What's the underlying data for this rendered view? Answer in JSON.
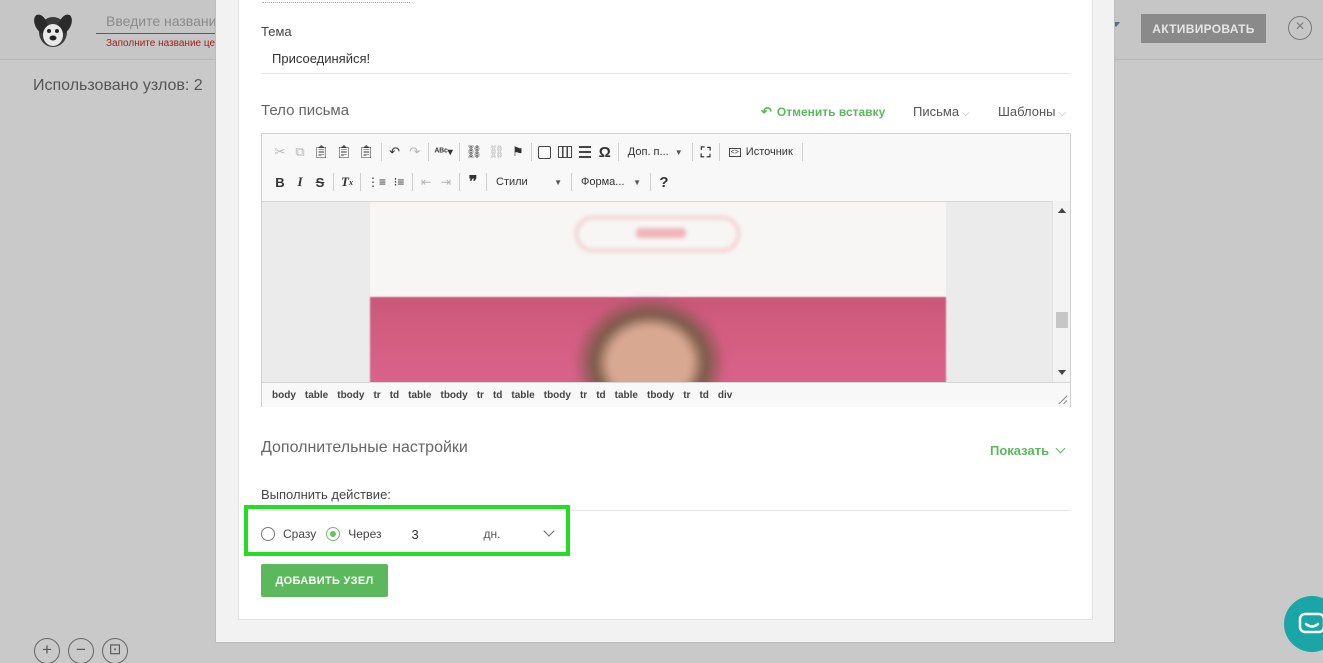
{
  "header": {
    "logo_icon": "dog-logo-icon",
    "name_placeholder": "Введите название",
    "name_error": "Заполните название цепочки",
    "activate_label": "АКТИВИРОВАТЬ",
    "close_icon": "close-icon"
  },
  "canvas": {
    "nodes_used": "Использовано узлов: 2",
    "zoom_in": "+",
    "zoom_out": "−",
    "fit": "⊡"
  },
  "modal": {
    "subject_label": "Тема",
    "subject_value": "Присоединяйся!",
    "body_label": "Тело письма",
    "undo_paste": "Отменить вставку",
    "letters_dropdown": "Письма",
    "templates_dropdown": "Шаблоны",
    "editor": {
      "toolbar_row1": {
        "more_combo": "Доп. п...",
        "source_label": "Источник"
      },
      "toolbar_row2": {
        "styles_combo": "Стили",
        "format_combo": "Форма...",
        "help": "?"
      },
      "path": [
        "body",
        "table",
        "tbody",
        "tr",
        "td",
        "table",
        "tbody",
        "tr",
        "td",
        "table",
        "tbody",
        "tr",
        "td",
        "table",
        "tbody",
        "tr",
        "td",
        "div"
      ]
    },
    "extra_settings_label": "Дополнительные настройки",
    "show_label": "Показать",
    "action_label": "Выполнить действие:",
    "immediately_label": "Сразу",
    "after_label": "Через",
    "selected_option": "after",
    "days_value": "3",
    "unit_value": "дн.",
    "add_node_label": "ДОБАВИТЬ УЗЕЛ"
  },
  "colors": {
    "accent_green": "#5cb85c",
    "highlight_green": "#22dd22",
    "chat_teal": "#1aa6a6"
  }
}
